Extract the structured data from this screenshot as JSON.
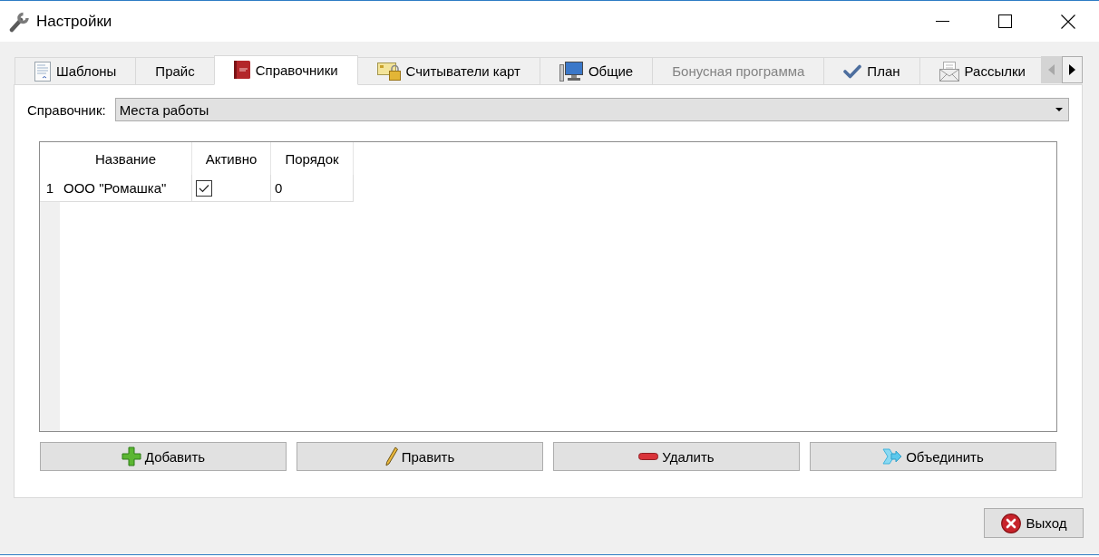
{
  "window": {
    "title": "Настройки"
  },
  "tabs": [
    {
      "label": "Шаблоны",
      "selected": false,
      "disabled": false
    },
    {
      "label": "Прайс",
      "selected": false,
      "disabled": false
    },
    {
      "label": "Справочники",
      "selected": true,
      "disabled": false
    },
    {
      "label": "Считыватели карт",
      "selected": false,
      "disabled": false
    },
    {
      "label": "Общие",
      "selected": false,
      "disabled": false
    },
    {
      "label": "Бонусная программа",
      "selected": false,
      "disabled": true
    },
    {
      "label": "План",
      "selected": false,
      "disabled": false
    },
    {
      "label": "Рассылки",
      "selected": false,
      "disabled": false
    }
  ],
  "tab_scroll": {
    "back_enabled": false,
    "forward_enabled": true
  },
  "directory_selector": {
    "label": "Справочник:",
    "value": "Места работы"
  },
  "table": {
    "columns": [
      "Название",
      "Активно",
      "Порядок"
    ],
    "rows": [
      {
        "number": "1",
        "name": "ООО \"Ромашка\"",
        "active": true,
        "order": "0"
      }
    ]
  },
  "actions": [
    {
      "label": "Добавить"
    },
    {
      "label": "Править"
    },
    {
      "label": "Удалить"
    },
    {
      "label": "Объединить"
    }
  ],
  "exit_button": {
    "label": "Выход"
  }
}
